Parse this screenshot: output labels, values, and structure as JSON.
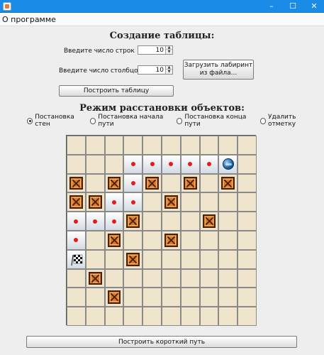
{
  "window": {
    "title": "",
    "minimize_glyph": "–",
    "maximize_glyph": "☐",
    "close_glyph": "✕"
  },
  "menu": {
    "about": "О программе"
  },
  "table_section": {
    "heading": "Создание таблицы:",
    "rows_label": "Введите число строк",
    "rows_value": "10",
    "cols_label": "Введите число столбцов",
    "cols_value": "10",
    "load_button_line1": "Загрузить лабиринт",
    "load_button_line2": "из файла...",
    "build_button": "Построить таблицу"
  },
  "mode_section": {
    "heading": "Режим расстановки объектов:",
    "options": [
      "Постановка стен",
      "Постановка начала пути",
      "Постановка конца пути",
      "Удалить отметку"
    ],
    "selected_index": 0
  },
  "maze": {
    "rows": 10,
    "cols": 10,
    "legend": {
      "wall": "W",
      "path": "P",
      "start": "S",
      "finish": "F",
      "empty": "."
    },
    "cells": [
      "..........",
      "...PPPPPS.",
      "W.WPW.W.W.",
      "WWPP.W....",
      "PPPW...W..",
      "P.W..W....",
      "F..W......",
      ".W........",
      "..W.......",
      ".........."
    ],
    "colors": {
      "floor": "#efe5cc",
      "wall": "#d97a2a",
      "path_dot": "#e31b1b",
      "grid_line": "#8a8a8a"
    }
  },
  "actions": {
    "shortest_path_button": "Построить короткий путь"
  },
  "icons": {
    "wall": "crate-icon",
    "start": "globe-icon",
    "finish": "checkered-flag-icon",
    "path": "dot-icon"
  }
}
